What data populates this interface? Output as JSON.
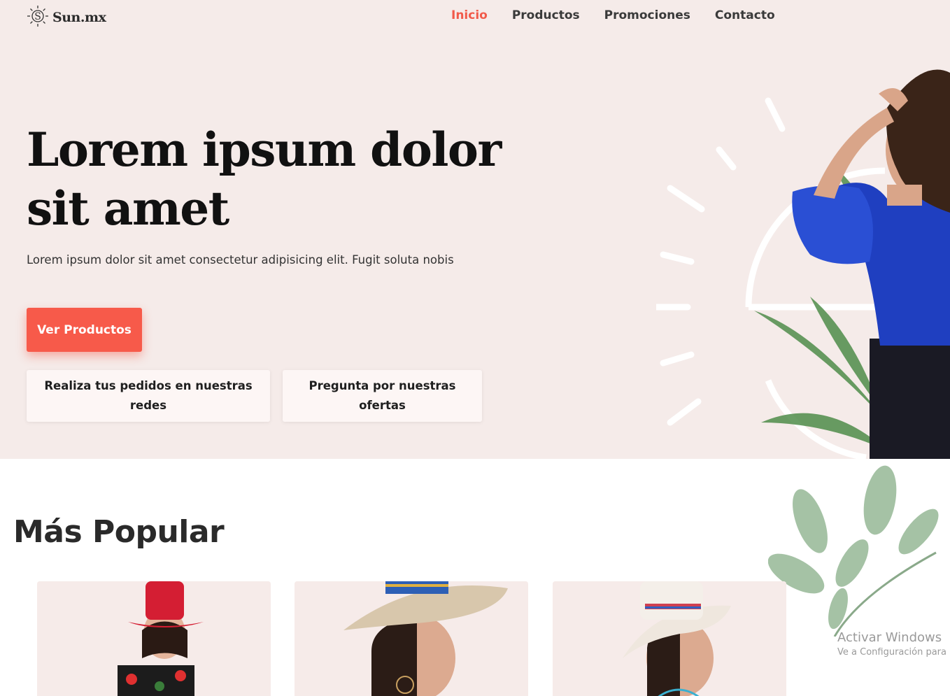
{
  "brand": {
    "name": "Sun.mx",
    "logo_icon": "sun-logo-icon"
  },
  "nav": {
    "items": [
      {
        "label": "Inicio",
        "active": true
      },
      {
        "label": "Productos",
        "active": false
      },
      {
        "label": "Promociones",
        "active": false
      },
      {
        "label": "Contacto",
        "active": false
      }
    ]
  },
  "hero": {
    "title": "Lorem ipsum dolor sit amet",
    "subtitle": "Lorem ipsum dolor sit amet consectetur adipisicing elit. Fugit soluta nobis",
    "cta_label": "Ver Productos",
    "cards": [
      {
        "label": "Realiza tus pedidos en nuestras redes"
      },
      {
        "label": "Pregunta por nuestras ofertas"
      }
    ]
  },
  "popular": {
    "title": "Más Popular",
    "products": [
      {
        "image": "woman-red-hat-photo"
      },
      {
        "image": "woman-beige-hat-photo"
      },
      {
        "image": "woman-white-hat-photo"
      }
    ]
  },
  "watermark": {
    "title": "Activar Windows",
    "subtitle": "Ve a Configuración para"
  },
  "colors": {
    "accent": "#f15a4a",
    "cta": "#f75a4a",
    "hero_bg": "#f5ebe9",
    "card_bg": "#fdf6f5",
    "blouse": "#1f3fc0"
  }
}
